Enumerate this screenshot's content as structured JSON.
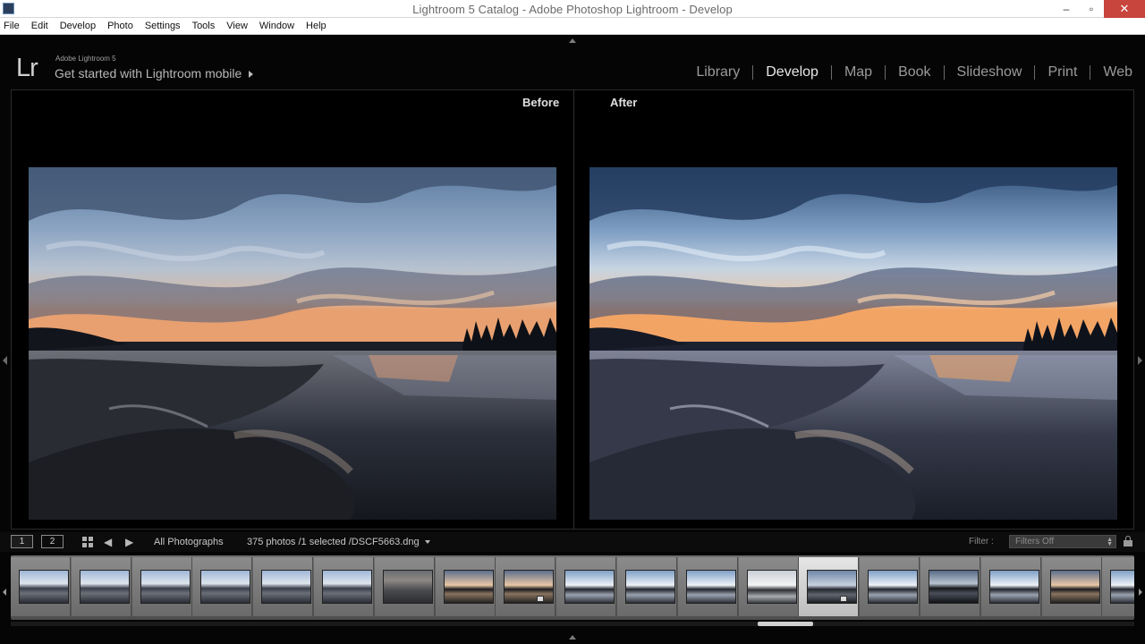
{
  "window": {
    "title": "Lightroom 5 Catalog - Adobe Photoshop Lightroom - Develop",
    "minimize": "–",
    "maximize": "▫",
    "close": "✕"
  },
  "menu": [
    "File",
    "Edit",
    "Develop",
    "Photo",
    "Settings",
    "Tools",
    "View",
    "Window",
    "Help"
  ],
  "identity_plate": {
    "logo": "Lr",
    "product": "Adobe Lightroom 5",
    "message": "Get started with Lightroom mobile"
  },
  "modules": [
    {
      "label": "Library",
      "active": false
    },
    {
      "label": "Develop",
      "active": true
    },
    {
      "label": "Map",
      "active": false
    },
    {
      "label": "Book",
      "active": false
    },
    {
      "label": "Slideshow",
      "active": false
    },
    {
      "label": "Print",
      "active": false
    },
    {
      "label": "Web",
      "active": false
    }
  ],
  "view": {
    "before_label": "Before",
    "after_label": "After"
  },
  "toolbar": {
    "screen1": "1",
    "screen2": "2",
    "source": "All Photographs",
    "count": "375 photos /1 selected /DSCF5663.dng",
    "filter_label": "Filter :",
    "filter_value": "Filters Off"
  },
  "filmstrip": {
    "thumbnails": [
      {
        "selected": false,
        "badge": false,
        "style": "dusk-calm"
      },
      {
        "selected": false,
        "badge": false,
        "style": "dusk-calm"
      },
      {
        "selected": false,
        "badge": false,
        "style": "dusk-calm"
      },
      {
        "selected": false,
        "badge": false,
        "style": "dusk-calm"
      },
      {
        "selected": false,
        "badge": false,
        "style": "dusk-calm"
      },
      {
        "selected": false,
        "badge": false,
        "style": "dusk-calm"
      },
      {
        "selected": false,
        "badge": false,
        "style": "rocks-dark"
      },
      {
        "selected": false,
        "badge": false,
        "style": "sunset-warm"
      },
      {
        "selected": false,
        "badge": true,
        "style": "sunset-warm"
      },
      {
        "selected": false,
        "badge": false,
        "style": "sky-bright"
      },
      {
        "selected": false,
        "badge": false,
        "style": "sky-bright"
      },
      {
        "selected": false,
        "badge": false,
        "style": "sky-bright"
      },
      {
        "selected": false,
        "badge": false,
        "style": "overcast"
      },
      {
        "selected": true,
        "badge": true,
        "style": "selected-dusk"
      },
      {
        "selected": false,
        "badge": false,
        "style": "sky-bright"
      },
      {
        "selected": false,
        "badge": false,
        "style": "dark-water"
      },
      {
        "selected": false,
        "badge": false,
        "style": "sky-bright"
      },
      {
        "selected": false,
        "badge": false,
        "style": "sunset-warm"
      },
      {
        "selected": false,
        "badge": false,
        "style": "sky-bright"
      }
    ]
  },
  "colors": {
    "accent": "#e8e8e8",
    "panel_bg": "#050505",
    "filmstrip_bg": "#6f6f6f",
    "close_button": "#c7453c"
  }
}
